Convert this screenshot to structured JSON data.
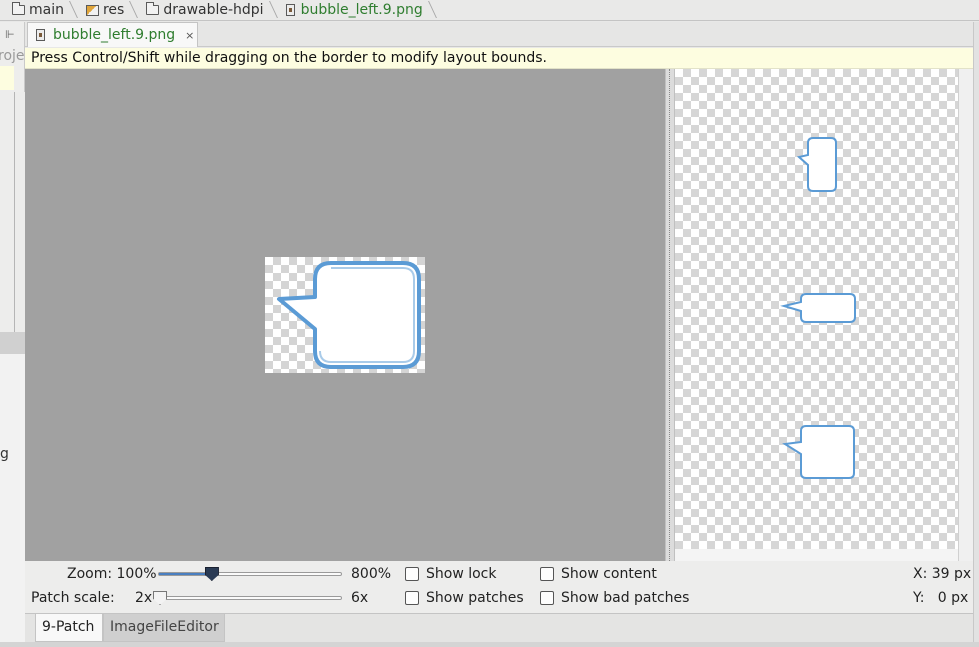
{
  "breadcrumb": {
    "items": [
      {
        "label": "main",
        "icon": "folder-icon"
      },
      {
        "label": "res",
        "icon": "res-folder-icon"
      },
      {
        "label": "drawable-hdpi",
        "icon": "folder-icon"
      },
      {
        "label": "bubble_left.9.png",
        "icon": "image-file-icon"
      }
    ]
  },
  "left_panel": {
    "partial_label": "roje",
    "partial_item": "g"
  },
  "editor_tab": {
    "label": "bubble_left.9.png",
    "close": "×"
  },
  "hint": "Press Control/Shift while dragging on the border to modify layout bounds.",
  "controls": {
    "zoom_label": "Zoom: 100%",
    "zoom_max": "800%",
    "zoom_fraction": 0.26,
    "patch_scale_label": "Patch scale:",
    "patch_scale_min": "2x",
    "patch_scale_max": "6x",
    "patch_scale_fraction": 0.0,
    "show_lock": "Show lock",
    "show_patches": "Show patches",
    "show_content": "Show content",
    "show_bad_patches": "Show bad patches",
    "show_lock_checked": false,
    "show_patches_checked": false,
    "show_content_checked": false,
    "show_bad_patches_checked": false,
    "x_readout": "X: 39 px",
    "y_readout": "Y:   0 px"
  },
  "bottom_tabs": [
    {
      "label": "9-Patch",
      "active": true
    },
    {
      "label": "ImageFileEditor",
      "active": false
    }
  ],
  "colors": {
    "bubble_stroke": "#5b9bd5",
    "accent_green": "#2f7d2f",
    "hint_bg": "#fdfde0",
    "canvas_bg": "#a1a1a1"
  }
}
